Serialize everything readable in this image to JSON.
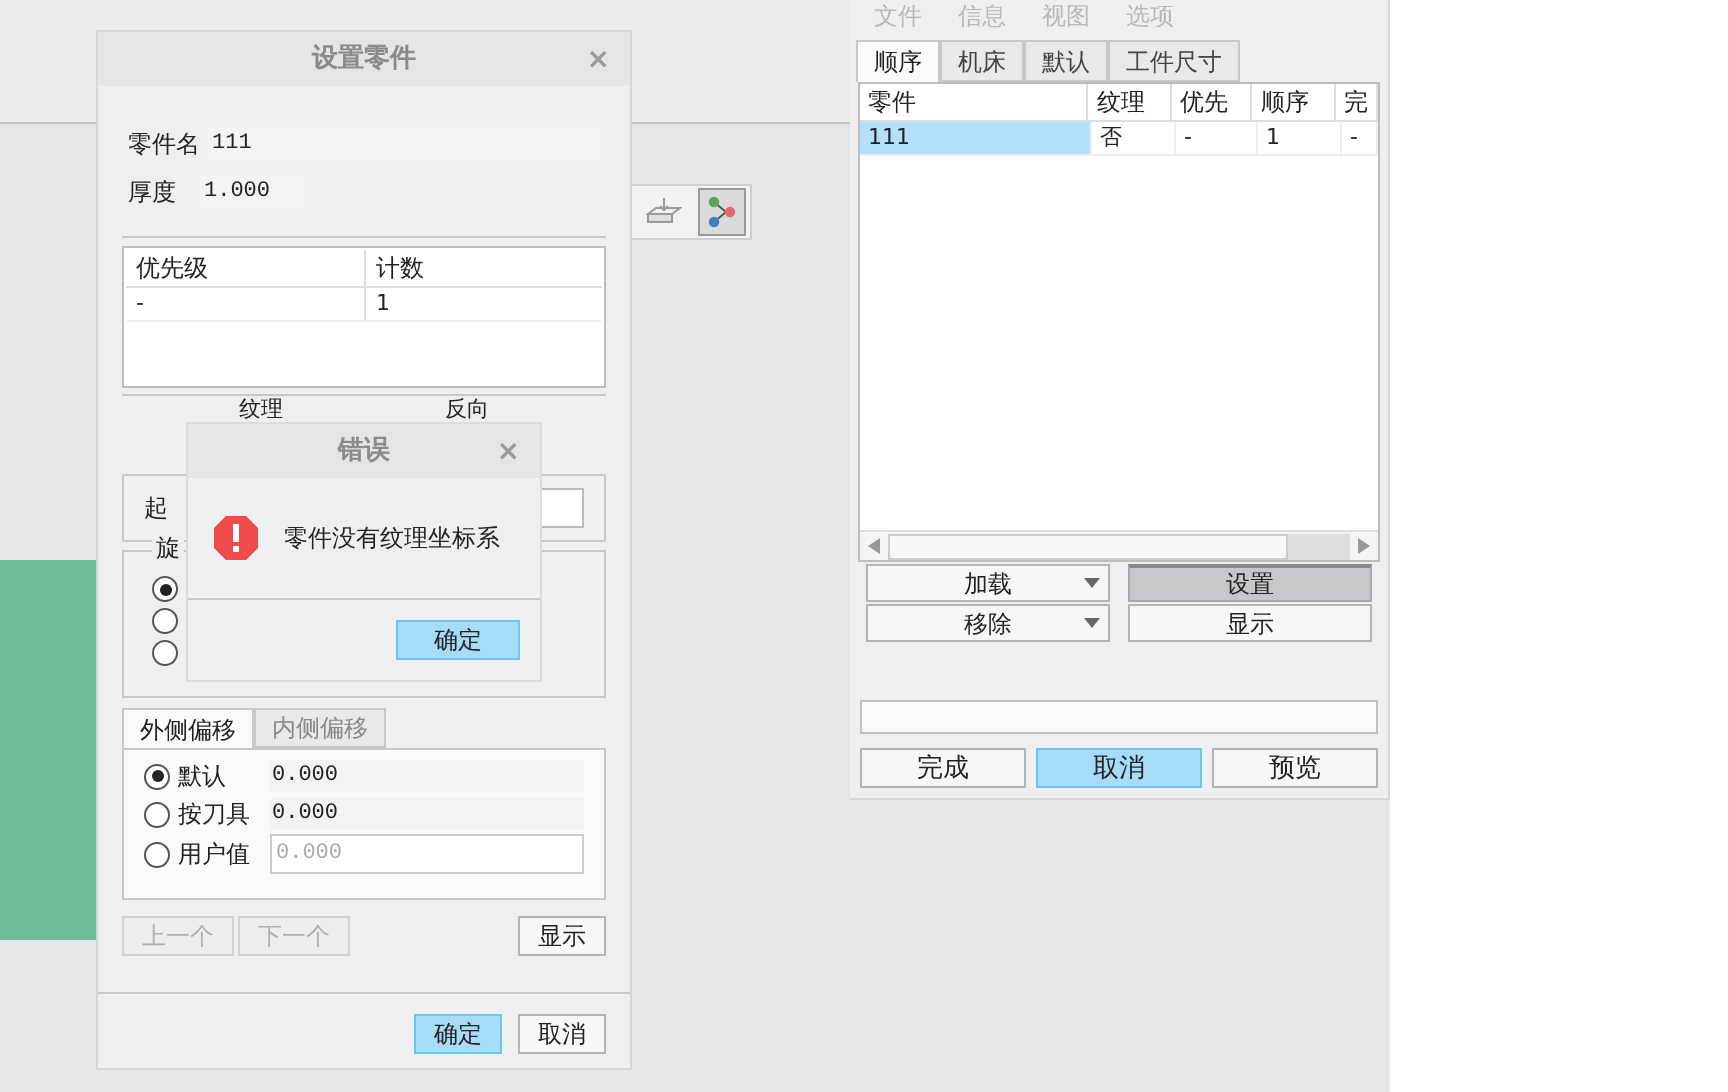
{
  "setup_dialog": {
    "title": "设置零件",
    "close": "×",
    "part_name_label": "零件名",
    "part_name": "111",
    "thickness_label": "厚度",
    "thickness": "1.000",
    "table": {
      "columns": [
        "优先级",
        "计数"
      ],
      "rows": [
        [
          "-",
          "1"
        ]
      ]
    },
    "section_labels": [
      "纹理",
      "反向"
    ],
    "start_label": "起",
    "rotate_label": "旋",
    "rotate_radios": [
      {
        "selected": true
      },
      {
        "selected": false
      },
      {
        "selected": false
      }
    ],
    "offset_tabs": [
      {
        "label": "外侧偏移",
        "selected": true
      },
      {
        "label": "内侧偏移",
        "selected": false
      }
    ],
    "offset_options": [
      {
        "label": "默认",
        "selected": true,
        "kind": "readout",
        "value": "0.000"
      },
      {
        "label": "按刀具",
        "selected": false,
        "kind": "readout",
        "value": "0.000"
      },
      {
        "label": "用户值",
        "selected": false,
        "kind": "input",
        "placeholder": "0.000"
      }
    ],
    "nav_buttons": [
      {
        "label": "上一个",
        "disabled": true
      },
      {
        "label": "下一个",
        "disabled": true
      }
    ],
    "show_button": "显示",
    "footer_buttons": [
      {
        "label": "确定",
        "primary": true
      },
      {
        "label": "取消",
        "primary": false
      }
    ]
  },
  "error_dialog": {
    "title": "错误",
    "close": "×",
    "message": "零件没有纹理坐标系",
    "ok": "确定"
  },
  "right_panel": {
    "menu": [
      {
        "label": "文件",
        "disabled": true
      },
      {
        "label": "信息",
        "disabled": true
      },
      {
        "label": "视图",
        "disabled": true
      },
      {
        "label": "选项",
        "disabled": true
      }
    ],
    "tabs": [
      {
        "label": "顺序",
        "selected": true
      },
      {
        "label": "机床",
        "selected": false
      },
      {
        "label": "默认",
        "selected": false
      },
      {
        "label": "工件尺寸",
        "selected": false
      }
    ],
    "table": {
      "columns": [
        "零件",
        "纹理",
        "优先",
        "顺序",
        "完"
      ],
      "rows": [
        {
          "cells": [
            "111",
            "否",
            "-",
            "1",
            "-"
          ],
          "selected": true
        }
      ]
    },
    "action_buttons": [
      {
        "label": "加载",
        "kind": "dropdown",
        "pressed": false
      },
      {
        "label": "设置",
        "kind": "plain",
        "pressed": true
      },
      {
        "label": "移除",
        "kind": "dropdown",
        "pressed": false
      },
      {
        "label": "显示",
        "kind": "plain",
        "pressed": false
      }
    ],
    "footer_buttons": [
      {
        "label": "完成",
        "primary": false
      },
      {
        "label": "取消",
        "primary": true
      },
      {
        "label": "预览",
        "primary": false
      }
    ]
  }
}
